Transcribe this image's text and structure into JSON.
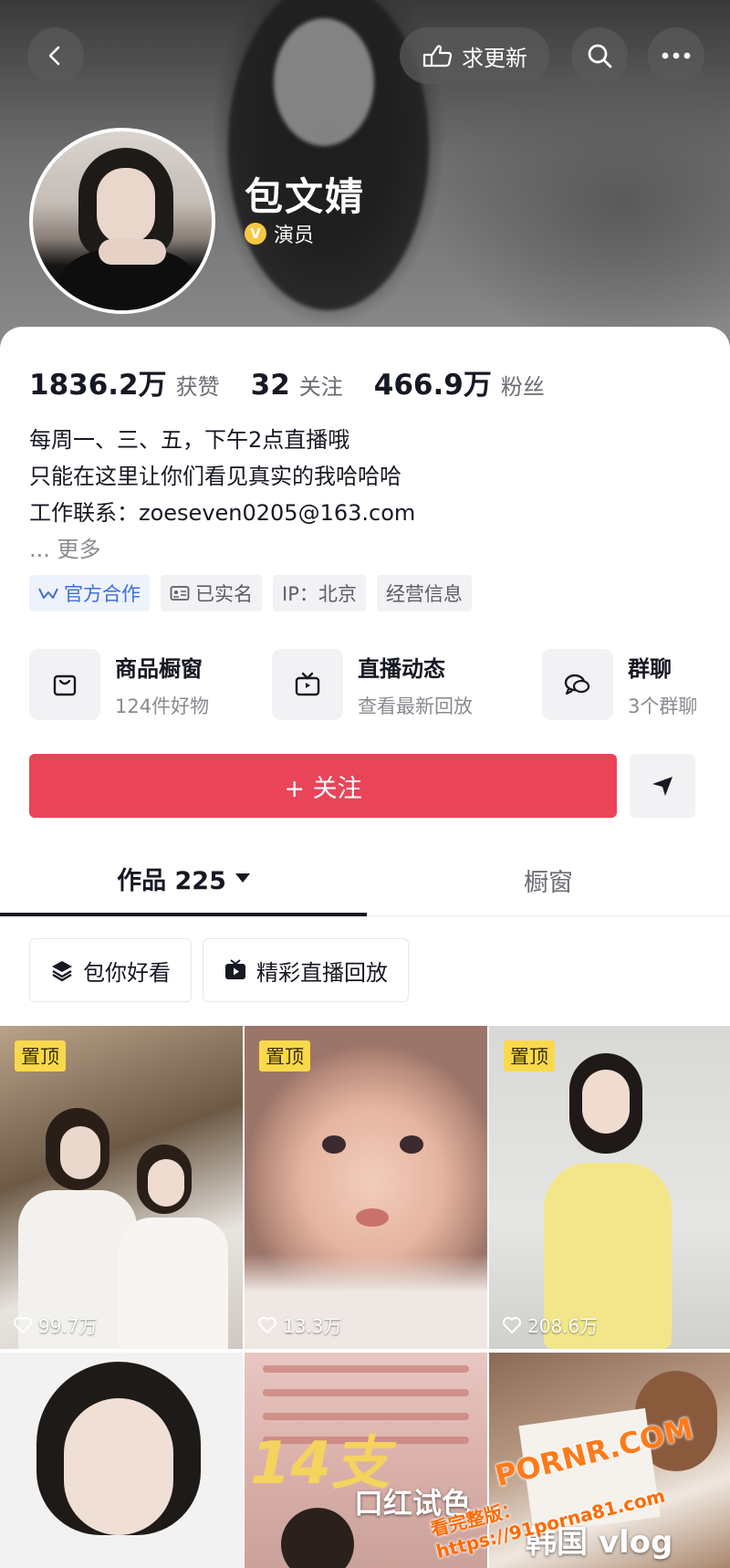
{
  "header": {
    "update_label": "求更新",
    "name": "包文婧",
    "verified_badge": "V",
    "role": "演员"
  },
  "stats": {
    "likes_value": "1836.2万",
    "likes_label": "获赞",
    "following_value": "32",
    "following_label": "关注",
    "followers_value": "466.9万",
    "followers_label": "粉丝"
  },
  "bio": {
    "line1": "每周一、三、五，下午2点直播哦",
    "line2": "只能在这里让你们看见真实的我哈哈哈",
    "line3": "工作联系：zoeseven0205@163.com",
    "more": "... 更多"
  },
  "tags": {
    "official": "官方合作",
    "verified": "已实名",
    "ip": "IP：北京",
    "business": "经营信息"
  },
  "entries": [
    {
      "title": "商品橱窗",
      "sub": "124件好物"
    },
    {
      "title": "直播动态",
      "sub": "查看最新回放"
    },
    {
      "title": "群聊",
      "sub": "3个群聊"
    }
  ],
  "follow_label": "+ 关注",
  "tabs": {
    "works": "作品 225",
    "window": "橱窗"
  },
  "collections": [
    {
      "label": "包你好看"
    },
    {
      "label": "精彩直播回放"
    }
  ],
  "videos": [
    {
      "pinned": "置顶",
      "likes": "99.7万"
    },
    {
      "pinned": "置顶",
      "likes": "13.3万"
    },
    {
      "pinned": "置顶",
      "likes": "208.6万"
    },
    {
      "overlay": ""
    },
    {
      "overlay_big": "14支",
      "overlay_sub": "口红试色"
    },
    {
      "overlay_sub": "韩国 vlog"
    }
  ],
  "watermark": {
    "line1": "PORNR.COM",
    "line2": "看完整版：https://91porna81.com"
  },
  "colors": {
    "accent_red": "#ea4459",
    "pin_yellow": "#f9d94b",
    "verified_yellow": "#f7c744",
    "tag_blue": "#3c6fd8"
  }
}
